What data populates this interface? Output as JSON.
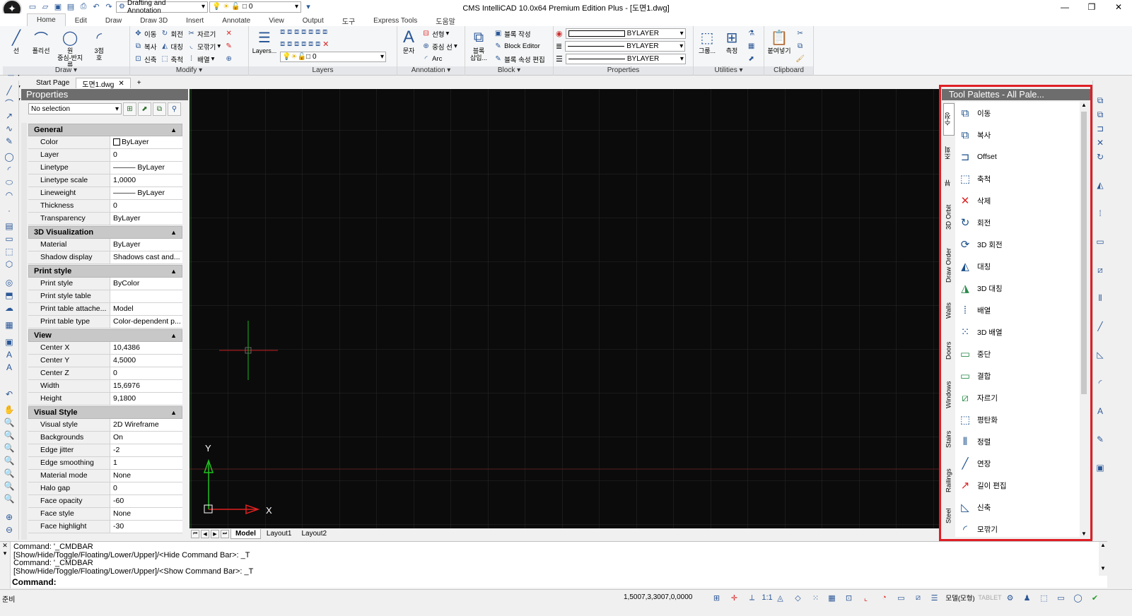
{
  "window": {
    "title": "CMS IntelliCAD 10.0x64 Premium Edition Plus  - [도면1.dwg]",
    "workspace": "Drafting and Annotation",
    "layer_quick": "0",
    "controls": [
      "—",
      "❐",
      "✕"
    ]
  },
  "menu_tabs": [
    "Home",
    "Edit",
    "Draw",
    "Draw 3D",
    "Insert",
    "Annotate",
    "View",
    "Output",
    "도구",
    "Express Tools",
    "도움말"
  ],
  "ribbon": {
    "draw": {
      "label": "Draw ▾",
      "large": [
        "선",
        "폴리선",
        "원\n중심-반지름",
        "3점\n호"
      ]
    },
    "modify": {
      "label": "Modify ▾",
      "items": [
        "이동",
        "회전",
        "자르기",
        "복사",
        "대칭",
        "모깎기",
        "신축",
        "축척",
        "배열"
      ]
    },
    "layers": {
      "label": "Layers",
      "large": "Layers...",
      "current": "0"
    },
    "annotation": {
      "label": "Annotation ▾",
      "large": "문자",
      "items": [
        "선형",
        "중심 선",
        "Arc"
      ]
    },
    "block": {
      "label": "Block ▾",
      "large": "블록\n삽입...",
      "items": [
        "블록 작성",
        "Block Editor",
        "블록 속성 편집"
      ]
    },
    "properties": {
      "label": "Properties",
      "color": "BYLAYER",
      "linetype": "BYLAYER",
      "lineweight": "BYLAYER"
    },
    "utilities": {
      "label": "Utilities ▾",
      "large": [
        "그룹...",
        "측정"
      ]
    },
    "clipboard": {
      "label": "Clipboard",
      "large": "붙여넣기"
    }
  },
  "doc_tabs": [
    "Start Page",
    "도면1.dwg"
  ],
  "properties_panel": {
    "title": "Properties",
    "selection": "No selection",
    "sections": [
      {
        "name": "General",
        "rows": [
          [
            "Color",
            "ByLayer"
          ],
          [
            "Layer",
            "0"
          ],
          [
            "Linetype",
            "——— ByLayer"
          ],
          [
            "Linetype scale",
            "1,0000"
          ],
          [
            "Lineweight",
            "——— ByLayer"
          ],
          [
            "Thickness",
            "0"
          ],
          [
            "Transparency",
            "ByLayer"
          ]
        ]
      },
      {
        "name": "3D Visualization",
        "rows": [
          [
            "Material",
            "ByLayer"
          ],
          [
            "Shadow display",
            "Shadows cast and..."
          ]
        ]
      },
      {
        "name": "Print style",
        "rows": [
          [
            "Print style",
            "ByColor"
          ],
          [
            "Print style table",
            ""
          ],
          [
            "Print table attache...",
            "Model"
          ],
          [
            "Print table type",
            "Color-dependent p..."
          ]
        ]
      },
      {
        "name": "View",
        "rows": [
          [
            "Center X",
            "10,4386"
          ],
          [
            "Center Y",
            "4,5000"
          ],
          [
            "Center Z",
            "0"
          ],
          [
            "Width",
            "15,6976"
          ],
          [
            "Height",
            "9,1800"
          ]
        ]
      },
      {
        "name": "Visual Style",
        "rows": [
          [
            "Visual style",
            "2D Wireframe"
          ],
          [
            "Backgrounds",
            "On"
          ],
          [
            "Edge jitter",
            "-2"
          ],
          [
            "Edge smoothing",
            "1"
          ],
          [
            "Material mode",
            "None"
          ],
          [
            "Halo gap",
            "0"
          ],
          [
            "Face opacity",
            "-60"
          ],
          [
            "Face style",
            "None"
          ],
          [
            "Face highlight",
            "-30"
          ]
        ]
      }
    ]
  },
  "canvas": {
    "axis_x": "X",
    "axis_y": "Y",
    "layout_tabs": [
      "Model",
      "Layout1",
      "Layout2"
    ]
  },
  "tool_palettes": {
    "title": "Tool Palettes - All Pale...",
    "tabs": [
      "수정",
      "조회",
      "뷰",
      "3D Orbit",
      "Draw Order",
      "Walls",
      "Doors",
      "Windows",
      "Stairs",
      "Railings",
      "Steel"
    ],
    "active_tab": "수정",
    "items": [
      "이동",
      "복사",
      "Offset",
      "축척",
      "삭제",
      "회전",
      "3D 회전",
      "대칭",
      "3D 대칭",
      "배열",
      "3D 배열",
      "중단",
      "결합",
      "자르기",
      "평탄화",
      "정렬",
      "연장",
      "길이 편집",
      "신축",
      "모깎기"
    ],
    "highlight_color": "#e01e25"
  },
  "command_bar": {
    "lines": [
      "Command: '_CMDBAR",
      "[Show/Hide/Toggle/Floating/Lower/Upper]/<Hide Command Bar>: _T",
      "Command: '_CMDBAR",
      "[Show/Hide/Toggle/Floating/Lower/Upper]/<Show Command Bar>: _T"
    ],
    "prompt": "Command:"
  },
  "status_bar": {
    "ready": "준비",
    "coords": "1,5007,3,3007,0,0000",
    "scale": "1:1",
    "model": "모델(모형)",
    "tablet": "TABLET"
  }
}
